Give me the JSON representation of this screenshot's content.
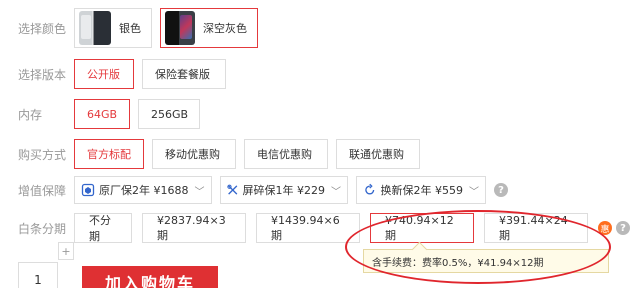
{
  "color_row": {
    "label": "选择颜色",
    "options": [
      {
        "name": "银色",
        "selected": false
      },
      {
        "name": "深空灰色",
        "selected": true
      }
    ]
  },
  "version_row": {
    "label": "选择版本",
    "options": [
      {
        "name": "公开版",
        "selected": true
      },
      {
        "name": "保险套餐版",
        "selected": false
      }
    ]
  },
  "storage_row": {
    "label": "内存",
    "options": [
      {
        "name": "64GB",
        "selected": true
      },
      {
        "name": "256GB",
        "selected": false
      }
    ]
  },
  "purchase_row": {
    "label": "购买方式",
    "options": [
      {
        "name": "官方标配",
        "selected": true
      },
      {
        "name": "移动优惠购",
        "selected": false
      },
      {
        "name": "电信优惠购",
        "selected": false
      },
      {
        "name": "联通优惠购",
        "selected": false
      }
    ]
  },
  "service_row": {
    "label": "增值保障",
    "options": [
      {
        "name": "原厂保2年 ¥1688",
        "icon": "shield-icon"
      },
      {
        "name": "屏碎保1年 ¥229",
        "icon": "tools-icon"
      },
      {
        "name": "换新保2年 ¥559",
        "icon": "refresh-icon"
      }
    ]
  },
  "installment_row": {
    "label": "白条分期",
    "options": [
      {
        "name": "不分期",
        "selected": false
      },
      {
        "name": "¥2837.94×3期",
        "selected": false
      },
      {
        "name": "¥1439.94×6期",
        "selected": false
      },
      {
        "name": "¥740.94×12期",
        "selected": true
      },
      {
        "name": "¥391.44×24期",
        "selected": false
      }
    ],
    "badge": "惠",
    "tooltip": "含手续费：费率0.5%，¥41.94×12期"
  },
  "buy": {
    "quantity": "1",
    "plus": "+",
    "cart_label": "加入购物车"
  },
  "colors": {
    "accent": "#e4393c",
    "cart": "#df3033"
  }
}
